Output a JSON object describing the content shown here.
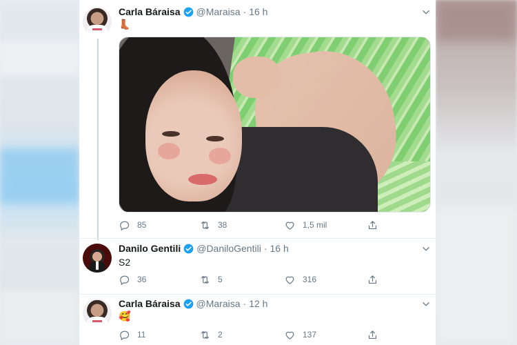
{
  "tweets": [
    {
      "author": "Carla Báraisa",
      "handle": "@Maraisa",
      "separator": "·",
      "time": "16 h",
      "text": "👢",
      "replies": "85",
      "retweets": "38",
      "likes": "1,5 mil"
    },
    {
      "author": "Danilo Gentili",
      "handle": "@DaniloGentili",
      "separator": "·",
      "time": "16 h",
      "text": "S2",
      "replies": "36",
      "retweets": "5",
      "likes": "316"
    },
    {
      "author": "Carla Báraisa",
      "handle": "@Maraisa",
      "separator": "·",
      "time": "12 h",
      "text": "🥰",
      "replies": "11",
      "retweets": "2",
      "likes": "137"
    }
  ],
  "colors": {
    "verified": "#1da1f2",
    "secondary_text": "#657786",
    "primary_text": "#14171a"
  },
  "icons": [
    "verified-icon",
    "chevron-down-icon",
    "reply-icon",
    "retweet-icon",
    "like-icon",
    "share-icon"
  ]
}
